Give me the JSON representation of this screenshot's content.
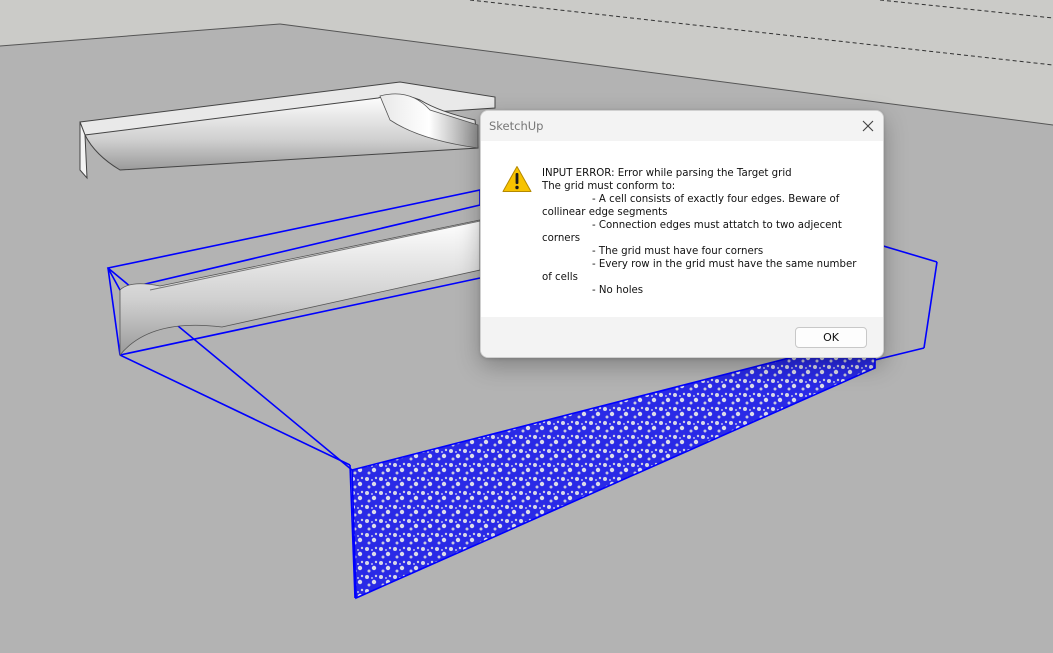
{
  "dialog": {
    "title": "SketchUp",
    "icon": "warning-icon",
    "message_lines": [
      {
        "text": "INPUT ERROR: Error while parsing the Target grid",
        "indent": false
      },
      {
        "text": "The grid must conform to:",
        "indent": false
      },
      {
        "text": "- A cell consists of exactly four edges. Beware of",
        "indent": true
      },
      {
        "text": "collinear edge segments",
        "indent": false
      },
      {
        "text": "- Connection edges must attatch to two adjecent",
        "indent": true
      },
      {
        "text": "corners",
        "indent": false
      },
      {
        "text": "- The grid must have four corners",
        "indent": true
      },
      {
        "text": "- Every row in the grid must have the same number",
        "indent": true
      },
      {
        "text": "of cells",
        "indent": false
      },
      {
        "text": "- No holes",
        "indent": true
      }
    ],
    "ok_label": "OK",
    "close_icon": "close-icon"
  },
  "colors": {
    "viewport_ground": "#b3b3b3",
    "sky": "#cbcbc8",
    "selection_blue": "#0000ff",
    "warning_yellow": "#f7c300"
  }
}
